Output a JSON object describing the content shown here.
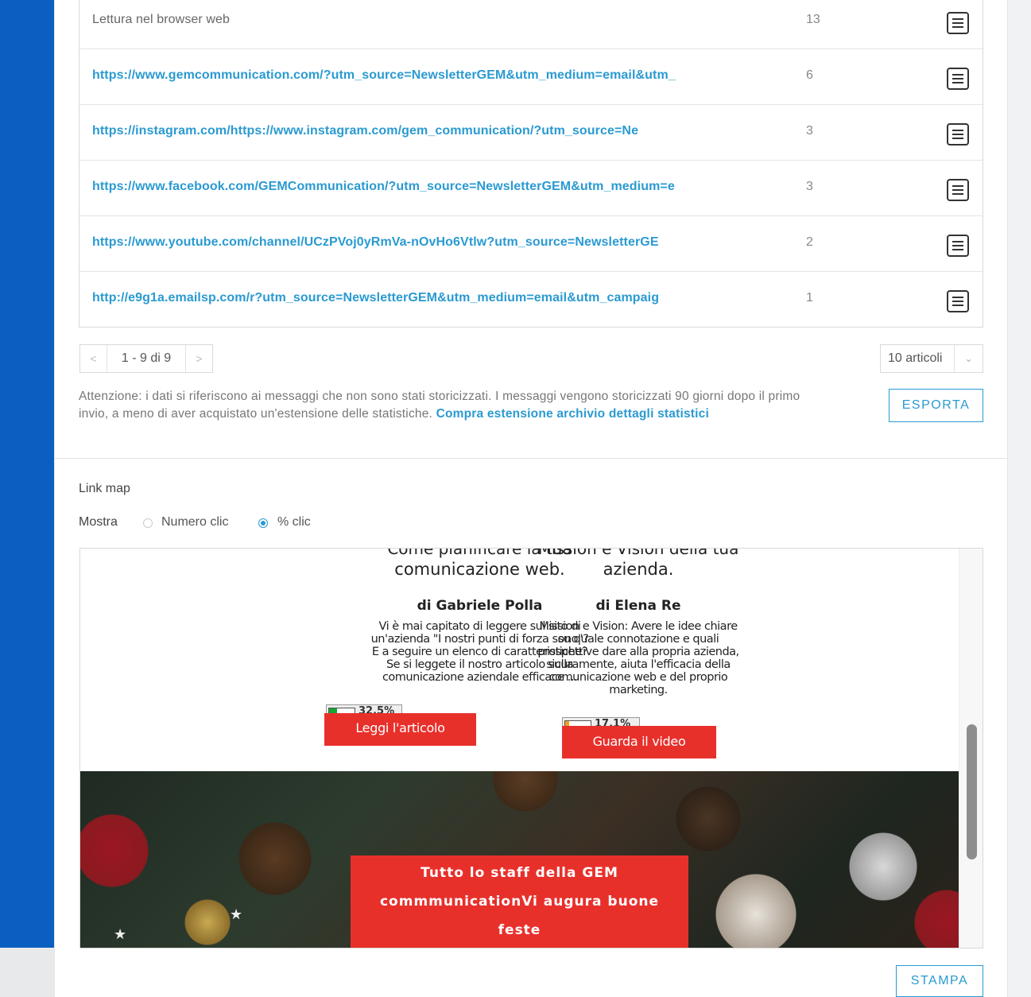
{
  "links_table": {
    "rows": [
      {
        "url": "Lettura nel browser web",
        "count": "13",
        "is_link": false
      },
      {
        "url": "https://www.gemcommunication.com/?utm_source=NewsletterGEM&utm_medium=email&utm_",
        "count": "6",
        "is_link": true
      },
      {
        "url": "https://instagram.com/https://www.instagram.com/gem_communication/?utm_source=Ne",
        "count": "3",
        "is_link": true
      },
      {
        "url": "https://www.facebook.com/GEMCommunication/?utm_source=NewsletterGEM&utm_medium=e",
        "count": "3",
        "is_link": true
      },
      {
        "url": "https://www.youtube.com/channel/UCzPVoj0yRmVa-nOvHo6Vtlw?utm_source=NewsletterGE",
        "count": "2",
        "is_link": true
      },
      {
        "url": "http://e9g1a.emailsp.com/r?utm_source=NewsletterGEM&utm_medium=email&utm_campaig",
        "count": "1",
        "is_link": true
      }
    ]
  },
  "pagination": {
    "prev": "<",
    "label": "1 - 9 di 9",
    "next": ">",
    "per_page": "10 articoli",
    "chevron": "⌄"
  },
  "notice": {
    "text": "Attenzione: i dati si riferiscono ai messaggi che non sono stati storicizzati. I messaggi vengono storicizzati 90 giorni dopo il primo invio, a meno di aver acquistato un'estensione delle statistiche. ",
    "link": "Compra estensione archivio dettagli statistici"
  },
  "export_label": "ESPORTA",
  "link_map": {
    "title": "Link map",
    "show_label": "Mostra",
    "option_count": "Numero clic",
    "option_percent": "% clic",
    "selected": "percent"
  },
  "preview": {
    "left": {
      "cut_title": "Come pianificare la tua",
      "title": "comunicazione web.",
      "author": "di Gabriele Polla",
      "body": "Vi è mai capitato di leggere sul sito di un'azienda \"I nostri punti di forza sono\"? E a seguire un elenco di caratteristiche? Se si leggete il nostro articolo sulla comunicazione aziendale efficace ...",
      "percent": "32.5%",
      "percent_value": 32.5,
      "button": "Leggi l'articolo"
    },
    "right": {
      "cut_title": "Mission e Vision della tua",
      "title": "azienda.",
      "author": "di Elena Re",
      "body": "Mission e Vision: Avere le idee chiare su quale connotazione e quali prospettive dare alla propria azienda, sicuramente, aiuta l'efficacia della comunicazione web e del proprio marketing.",
      "percent": "17.1%",
      "percent_value": 17.1,
      "button": "Guarda il video"
    },
    "banner_line1": "Tutto lo staff della GEM",
    "banner_line2": "commmunicationVi augura buone",
    "banner_line3": "feste"
  },
  "print_label": "STAMPA",
  "colors": {
    "accent": "#2a9ad1",
    "brand_red": "#e8302b",
    "background_blue": "#0a5fc0"
  }
}
